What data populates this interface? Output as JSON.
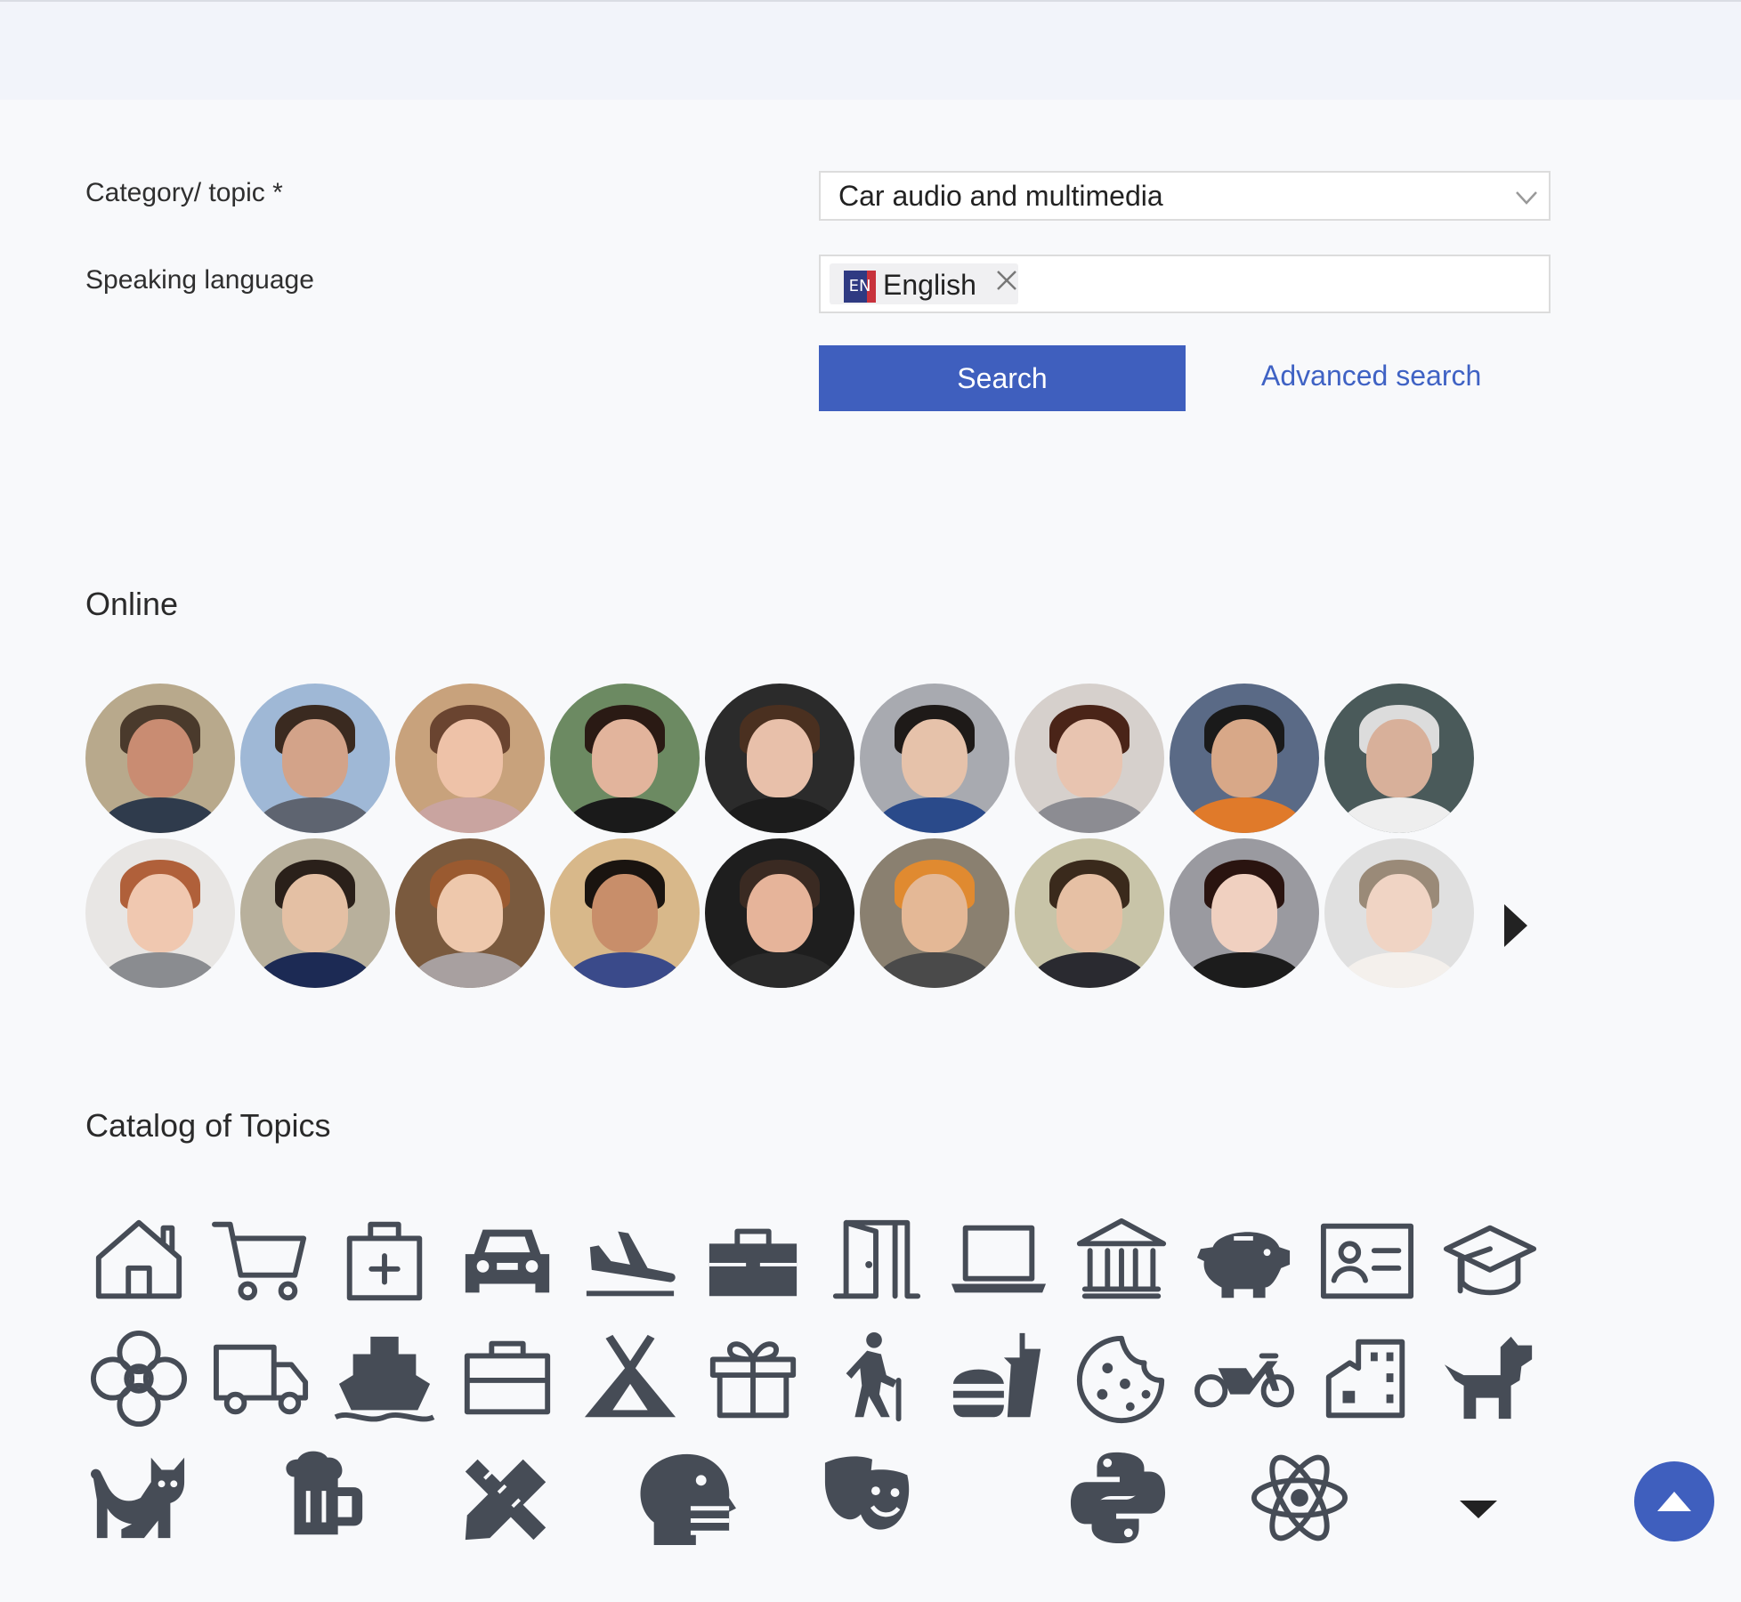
{
  "form": {
    "category_label": "Category/ topic *",
    "category_value": "Car audio and multimedia",
    "language_label": "Speaking language",
    "language_chip_code": "EN",
    "language_chip_label": "English",
    "search_label": "Search",
    "advanced_label": "Advanced search"
  },
  "online": {
    "title": "Online",
    "avatars": [
      {
        "bg": "#b8a98c",
        "skin": "#c98c72",
        "cloth": "#2f3b4c",
        "hair": "#4a3a2c"
      },
      {
        "bg": "#9fb8d6",
        "skin": "#d3a389",
        "cloth": "#5e6470",
        "hair": "#3a2a20"
      },
      {
        "bg": "#c8a27c",
        "skin": "#eec2a8",
        "cloth": "#c9a4a0",
        "hair": "#6a4430"
      },
      {
        "bg": "#6c8a62",
        "skin": "#e2b49c",
        "cloth": "#1a1a1a",
        "hair": "#2a1a14"
      },
      {
        "bg": "#2b2b2b",
        "skin": "#e8c0aa",
        "cloth": "#1c1c1c",
        "hair": "#4a3020"
      },
      {
        "bg": "#a8aab0",
        "skin": "#e6c2aa",
        "cloth": "#2a4a8a",
        "hair": "#1e1a18"
      },
      {
        "bg": "#d6d0cc",
        "skin": "#e8c4b0",
        "cloth": "#8c8c92",
        "hair": "#4a2418"
      },
      {
        "bg": "#5a6a86",
        "skin": "#d8a888",
        "cloth": "#e07a2a",
        "hair": "#1a1a1a"
      },
      {
        "bg": "#4a5a5a",
        "skin": "#d8b09a",
        "cloth": "#eeeeee",
        "hair": "#dcdcdc"
      },
      {
        "bg": "#e8e6e4",
        "skin": "#f0c8b0",
        "cloth": "#8a8c90",
        "hair": "#b0603a"
      },
      {
        "bg": "#b8b09c",
        "skin": "#e4c0a4",
        "cloth": "#1c2a54",
        "hair": "#2a201a"
      },
      {
        "bg": "#7a5a3e",
        "skin": "#eec8ac",
        "cloth": "#a8a0a0",
        "hair": "#9a5a30"
      },
      {
        "bg": "#d8b88a",
        "skin": "#c88e6a",
        "cloth": "#3a4a8a",
        "hair": "#1a1410"
      },
      {
        "bg": "#1e1e1e",
        "skin": "#e6b49a",
        "cloth": "#2a2a2a",
        "hair": "#3a2a22"
      },
      {
        "bg": "#8a8070",
        "skin": "#e4b896",
        "cloth": "#4a4a4a",
        "hair": "#e08a30"
      },
      {
        "bg": "#c8c4a8",
        "skin": "#e6c0a4",
        "cloth": "#2a2a30",
        "hair": "#3a2a1c"
      },
      {
        "bg": "#9a9aa0",
        "skin": "#f0d0c0",
        "cloth": "#1c1c1c",
        "hair": "#2a1410"
      },
      {
        "bg": "#e0e0e0",
        "skin": "#f0d4c4",
        "cloth": "#f4f0ec",
        "hair": "#9a8a78"
      }
    ]
  },
  "catalog": {
    "title": "Catalog of Topics",
    "icons": [
      "house-icon",
      "shopping-cart-icon",
      "medical-kit-icon",
      "car-icon",
      "plane-landing-icon",
      "toolbox-icon",
      "door-icon",
      "laptop-icon",
      "bank-icon",
      "piggy-bank-icon",
      "id-card-icon",
      "graduation-cap-icon",
      "flower-icon",
      "truck-icon",
      "ship-icon",
      "suitcase-icon",
      "tent-icon",
      "gift-icon",
      "hiking-icon",
      "fast-food-icon",
      "cookie-icon",
      "motorcycle-icon",
      "city-building-icon",
      "dog-icon",
      "cat-icon",
      "beer-mug-icon",
      "pencil-ruler-icon",
      "head-speaking-icon",
      "theater-masks-icon",
      "python-icon",
      "atom-icon"
    ]
  },
  "colors": {
    "accent": "#3f5fbe",
    "link": "#3f62c4",
    "icon": "#464c56",
    "background": "#f8f9fb"
  }
}
